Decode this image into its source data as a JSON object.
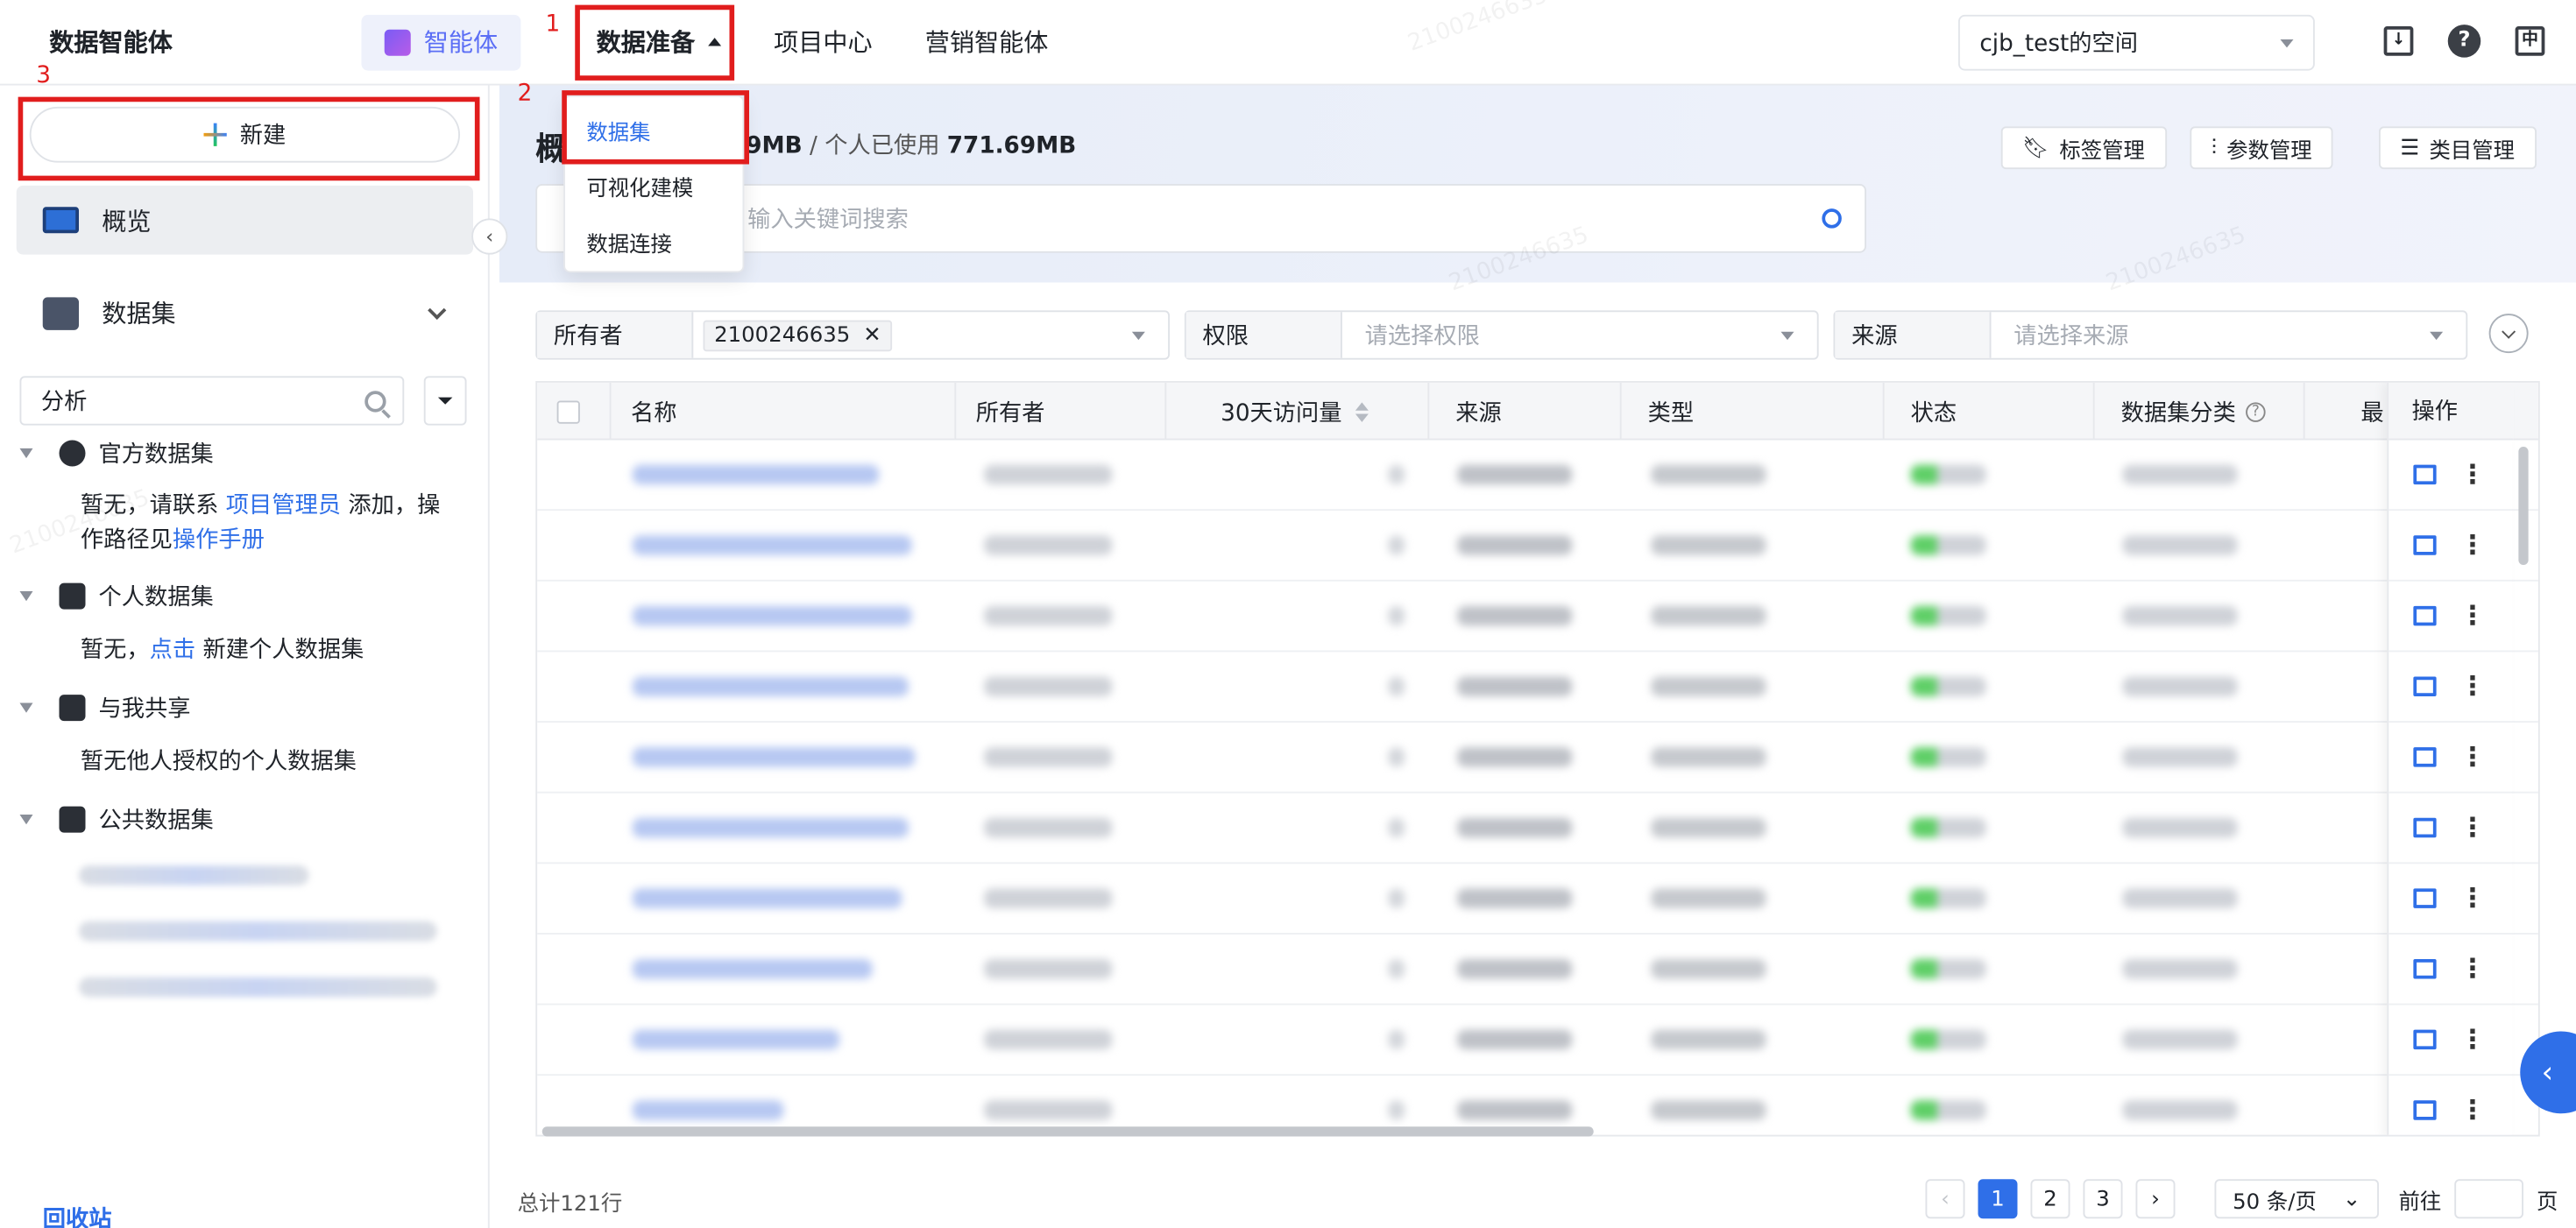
{
  "app": {
    "title": "数据智能体"
  },
  "nav": {
    "agent_label": "智能体",
    "items": [
      {
        "label": "数据准备"
      },
      {
        "label": "项目中心"
      },
      {
        "label": "营销智能体"
      }
    ]
  },
  "dropdown": {
    "items": [
      "数据集",
      "可视化建模",
      "数据连接"
    ]
  },
  "space": {
    "label": "cjb_test的空间"
  },
  "sidebar": {
    "new_label": "新建",
    "overview_label": "概览",
    "dataset_label": "数据集",
    "search_value": "分析",
    "official": {
      "label": "官方数据集",
      "text_pre": "暂无，请联系 ",
      "link1": "项目管理员",
      "text_mid": " 添加，操作路径见",
      "link2": "操作手册"
    },
    "personal": {
      "label": "个人数据集",
      "text_pre": "暂无，",
      "link": "点击",
      "text_post": " 新建个人数据集"
    },
    "shared": {
      "label": "与我共享",
      "text": "暂无他人授权的个人数据集"
    },
    "public": {
      "label": "公共数据集"
    },
    "bottom_label": "回收站"
  },
  "hero": {
    "title": "概",
    "usage_total": "9MB",
    "usage_sep": " / ",
    "usage_personal_label": "个人已使用 ",
    "usage_personal": "771.69MB",
    "buttons": [
      "标签管理",
      "参数管理",
      "类目管理"
    ],
    "search_placeholder": "输入关键词搜索"
  },
  "filters": [
    {
      "label": "所有者",
      "tag": "2100246635",
      "placeholder": ""
    },
    {
      "label": "权限",
      "placeholder": "请选择权限"
    },
    {
      "label": "来源",
      "placeholder": "请选择来源"
    }
  ],
  "table": {
    "columns": [
      "名称",
      "所有者",
      "30天访问量",
      "来源",
      "类型",
      "状态",
      "数据集分类",
      "最",
      "操作"
    ],
    "row_count_visible": 10
  },
  "pagination": {
    "total": "总计121行",
    "pages": [
      "1",
      "2",
      "3"
    ],
    "current": "1",
    "page_size": "50 条/页",
    "goto_label": "前往",
    "page_suffix": "页"
  },
  "annotations": [
    "1",
    "2",
    "3"
  ],
  "watermark": "2100246635",
  "colors": {
    "accent": "#2f6fe8",
    "annotation": "#e11d1d"
  }
}
